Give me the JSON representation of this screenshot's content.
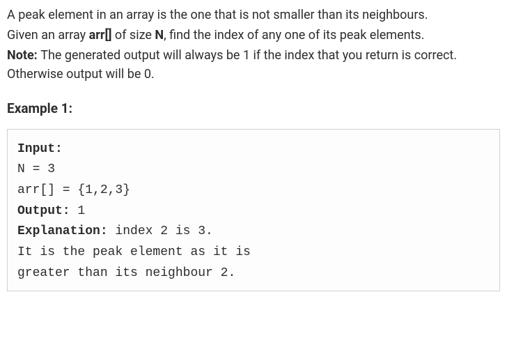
{
  "description": {
    "para1_a": "A peak element in an array is the one that is not smaller than its neighbours.",
    "para2_prefix": "Given an array ",
    "para2_bold1": "arr[]",
    "para2_mid": " of size ",
    "para2_bold2": "N",
    "para2_suffix": ", find the index of any one of its peak elements.",
    "note_label": "Note: ",
    "note_text": "The generated output will always be 1 if the index that you return is correct. Otherwise output will be 0."
  },
  "example": {
    "heading": "Example 1:",
    "input_label": "Input:",
    "input_line1": "N = 3",
    "input_line2": "arr[] = {1,2,3}",
    "output_label": "Output:",
    "output_value": " 1",
    "explanation_label": "Explanation:",
    "explanation_text": " index 2 is 3.\nIt is the peak element as it is \ngreater than its neighbour 2."
  }
}
